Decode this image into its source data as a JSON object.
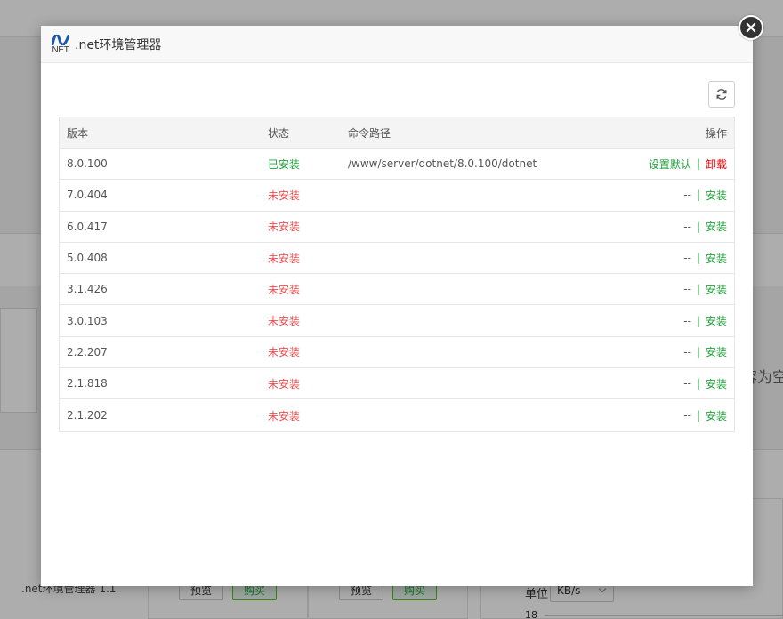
{
  "background": {
    "empty_text": "容为空",
    "plugin_label": ".net环境管理器 1.1",
    "preview_label": "预览",
    "buy_label": "购买",
    "unit_label": "单位",
    "unit_value": "KB/s",
    "axis_tick": "18"
  },
  "modal": {
    "title": ".net环境管理器",
    "logo_text": ".NET",
    "icons": {
      "refresh": "refresh-icon",
      "close": "close-icon",
      "logo": "dotnet-logo-icon"
    },
    "colors": {
      "installed": "#20a53a",
      "not_installed": "#ef4f4f",
      "uninstall": "#ef0000"
    },
    "table": {
      "headers": {
        "version": "版本",
        "status": "状态",
        "path": "命令路径",
        "action": "操作"
      },
      "rows": [
        {
          "version": "8.0.100",
          "status": "已安装",
          "path": "/www/server/dotnet/8.0.100/dotnet",
          "action_left": "设置默认",
          "separator": "|",
          "action_right": "卸载"
        },
        {
          "version": "7.0.404",
          "status": "未安装",
          "path": "",
          "action_left": "--",
          "separator": "|",
          "action_right": "安装"
        },
        {
          "version": "6.0.417",
          "status": "未安装",
          "path": "",
          "action_left": "--",
          "separator": "|",
          "action_right": "安装"
        },
        {
          "version": "5.0.408",
          "status": "未安装",
          "path": "",
          "action_left": "--",
          "separator": "|",
          "action_right": "安装"
        },
        {
          "version": "3.1.426",
          "status": "未安装",
          "path": "",
          "action_left": "--",
          "separator": "|",
          "action_right": "安装"
        },
        {
          "version": "3.0.103",
          "status": "未安装",
          "path": "",
          "action_left": "--",
          "separator": "|",
          "action_right": "安装"
        },
        {
          "version": "2.2.207",
          "status": "未安装",
          "path": "",
          "action_left": "--",
          "separator": "|",
          "action_right": "安装"
        },
        {
          "version": "2.1.818",
          "status": "未安装",
          "path": "",
          "action_left": "--",
          "separator": "|",
          "action_right": "安装"
        },
        {
          "version": "2.1.202",
          "status": "未安装",
          "path": "",
          "action_left": "--",
          "separator": "|",
          "action_right": "安装"
        }
      ]
    }
  }
}
